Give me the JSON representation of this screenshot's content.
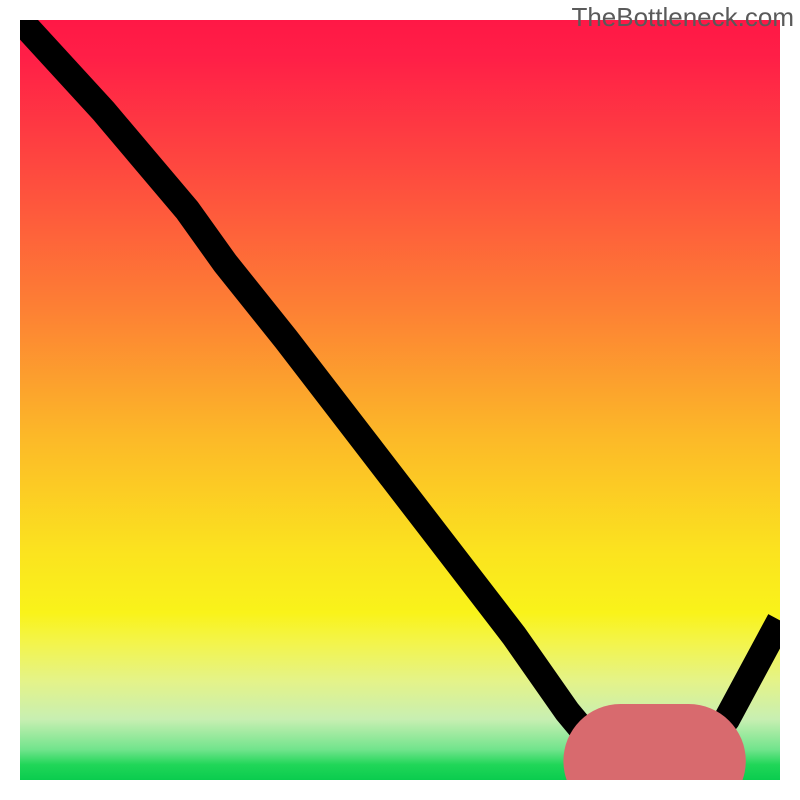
{
  "watermark": "TheBottleneck.com",
  "chart_data": {
    "type": "line",
    "title": "",
    "xlabel": "",
    "ylabel": "",
    "xrange": [
      0,
      100
    ],
    "yrange": [
      0,
      100
    ],
    "grid": false,
    "legend": false,
    "background": {
      "gradient_stops": [
        {
          "pos": 0.0,
          "color": "#ff1846"
        },
        {
          "pos": 0.05,
          "color": "#ff1f47"
        },
        {
          "pos": 0.2,
          "color": "#fe4a3f"
        },
        {
          "pos": 0.38,
          "color": "#fd8034"
        },
        {
          "pos": 0.55,
          "color": "#fcb928"
        },
        {
          "pos": 0.7,
          "color": "#fbe31f"
        },
        {
          "pos": 0.78,
          "color": "#f9f31a"
        },
        {
          "pos": 0.82,
          "color": "#f3f44c"
        },
        {
          "pos": 0.87,
          "color": "#e4f389"
        },
        {
          "pos": 0.92,
          "color": "#c8efb2"
        },
        {
          "pos": 0.96,
          "color": "#71e48c"
        },
        {
          "pos": 0.98,
          "color": "#20d658"
        },
        {
          "pos": 1.0,
          "color": "#0acc4e"
        }
      ]
    },
    "series": [
      {
        "name": "response-curve",
        "color": "#000000",
        "points": [
          {
            "x": 0,
            "y": 100
          },
          {
            "x": 11,
            "y": 88
          },
          {
            "x": 22,
            "y": 75
          },
          {
            "x": 27,
            "y": 68
          },
          {
            "x": 35,
            "y": 58
          },
          {
            "x": 45,
            "y": 45
          },
          {
            "x": 55,
            "y": 32
          },
          {
            "x": 65,
            "y": 19
          },
          {
            "x": 72,
            "y": 9
          },
          {
            "x": 77,
            "y": 3
          },
          {
            "x": 81,
            "y": 1
          },
          {
            "x": 85,
            "y": 1
          },
          {
            "x": 89,
            "y": 3
          },
          {
            "x": 93,
            "y": 8
          },
          {
            "x": 100,
            "y": 21
          }
        ]
      }
    ],
    "marker": {
      "name": "optimal-range",
      "color": "#d86a6e",
      "points": [
        {
          "x": 79,
          "y": 2.5
        },
        {
          "x": 88,
          "y": 2.5
        }
      ]
    },
    "_note": "Axis values are unitless 0-100 estimates read from a chart with no visible tick labels; y=0 is the bottom green edge, y=100 the top red edge."
  }
}
